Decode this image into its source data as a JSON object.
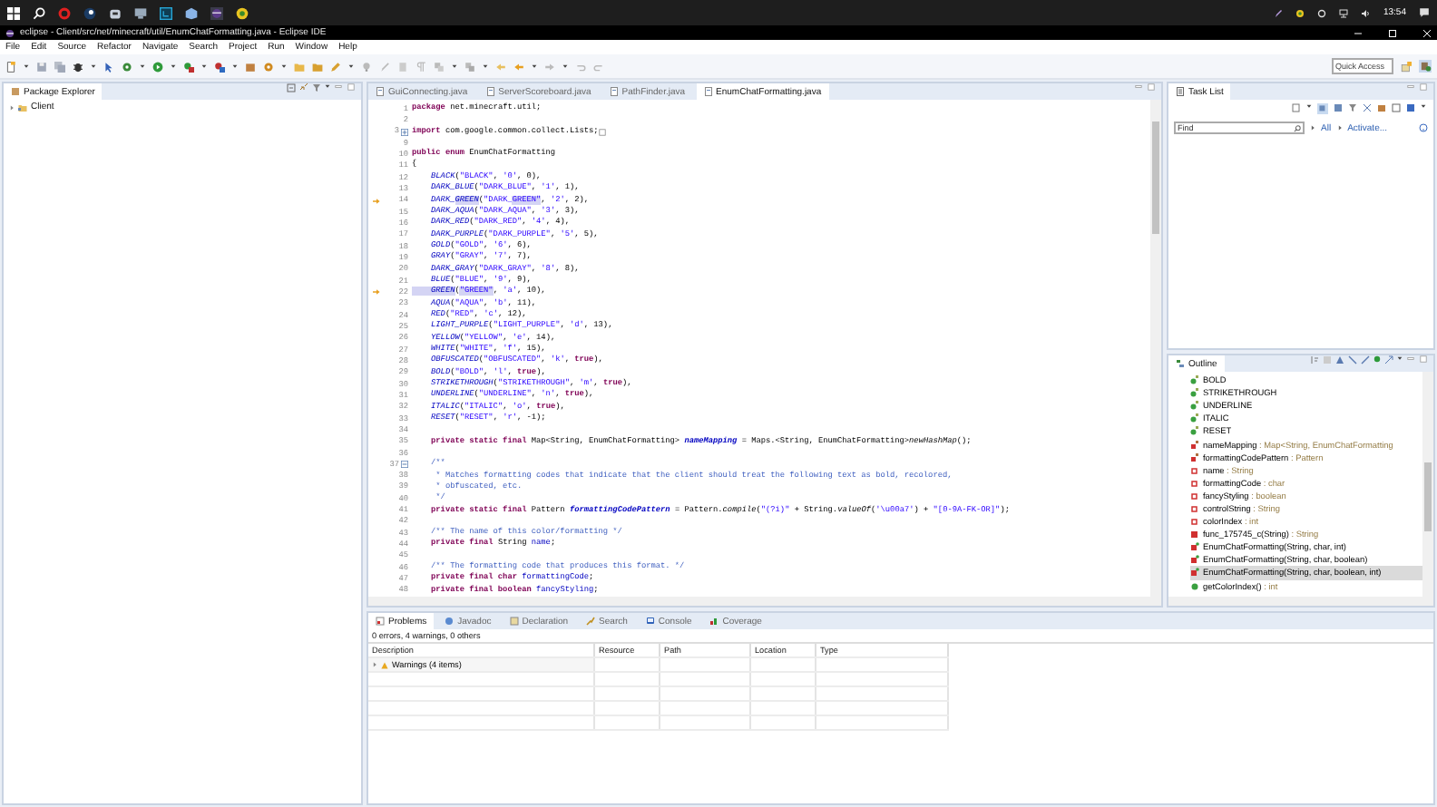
{
  "taskbar": {
    "time": "13:54"
  },
  "window": {
    "title": "eclipse - Client/src/net/minecraft/util/EnumChatFormatting.java - Eclipse IDE"
  },
  "menu": [
    "File",
    "Edit",
    "Source",
    "Refactor",
    "Navigate",
    "Search",
    "Project",
    "Run",
    "Window",
    "Help"
  ],
  "toolbar": {
    "quick_access": {
      "placeholder": "Quick Access"
    }
  },
  "package_explorer": {
    "title": "Package Explorer",
    "items": [
      {
        "label": "Client",
        "expanded": false
      }
    ]
  },
  "editor": {
    "tabs": [
      {
        "label": "GuiConnecting.java",
        "selected": false
      },
      {
        "label": "ServerScoreboard.java",
        "selected": false
      },
      {
        "label": "PathFinder.java",
        "selected": false
      },
      {
        "label": "EnumChatFormatting.java",
        "selected": true
      }
    ],
    "lines": [
      {
        "n": "1",
        "kind": "plain",
        "tokens": [
          {
            "kind": "kw",
            "text": "package "
          },
          {
            "kind": "plain",
            "text": "net.minecraft.util;"
          }
        ]
      },
      {
        "n": "2",
        "kind": "plain"
      },
      {
        "n": "3",
        "kind": "collapsed",
        "tokens": [
          {
            "kind": "kw",
            "text": "import "
          },
          {
            "kind": "plain",
            "text": "com.google.common.collect.Lists;"
          }
        ]
      },
      {
        "n": "9",
        "kind": "plain"
      },
      {
        "n": "10",
        "kind": "plain",
        "tokens": [
          {
            "kind": "kw",
            "text": "public enum "
          },
          {
            "kind": "plain",
            "text": "EnumChatFormatting"
          }
        ]
      },
      {
        "n": "11",
        "kind": "plain",
        "tokens": [
          {
            "kind": "plain",
            "text": "{"
          }
        ]
      },
      {
        "n": "12",
        "kind": "plain",
        "tokens": [
          {
            "kind": "const",
            "text": "    BLACK"
          },
          {
            "kind": "plain",
            "text": "("
          },
          {
            "kind": "str",
            "text": "\"BLACK\""
          },
          {
            "kind": "plain",
            "text": ", "
          },
          {
            "kind": "str",
            "text": "'0'"
          },
          {
            "kind": "plain",
            "text": ", 0),"
          }
        ]
      },
      {
        "n": "13",
        "kind": "plain",
        "tokens": [
          {
            "kind": "const",
            "text": "    DARK_BLUE"
          },
          {
            "kind": "plain",
            "text": "("
          },
          {
            "kind": "str",
            "text": "\"DARK_BLUE\""
          },
          {
            "kind": "plain",
            "text": ", "
          },
          {
            "kind": "str",
            "text": "'1'"
          },
          {
            "kind": "plain",
            "text": ", 1),"
          }
        ]
      },
      {
        "n": "14",
        "kind": "occurrence",
        "tokens": [
          {
            "kind": "const",
            "text": "    DARK_"
          },
          {
            "kind": "consthl",
            "text": "GREEN"
          },
          {
            "kind": "plain",
            "text": "("
          },
          {
            "kind": "str",
            "text": "\"DARK_"
          },
          {
            "kind": "strhl",
            "text": "GREEN\""
          },
          {
            "kind": "plain",
            "text": ", "
          },
          {
            "kind": "str",
            "text": "'2'"
          },
          {
            "kind": "plain",
            "text": ", 2),"
          }
        ]
      },
      {
        "n": "15",
        "kind": "plain",
        "tokens": [
          {
            "kind": "const",
            "text": "    DARK_AQUA"
          },
          {
            "kind": "plain",
            "text": "("
          },
          {
            "kind": "str",
            "text": "\"DARK_AQUA\""
          },
          {
            "kind": "plain",
            "text": ", "
          },
          {
            "kind": "str",
            "text": "'3'"
          },
          {
            "kind": "plain",
            "text": ", 3),"
          }
        ]
      },
      {
        "n": "16",
        "kind": "plain",
        "tokens": [
          {
            "kind": "const",
            "text": "    DARK_RED"
          },
          {
            "kind": "plain",
            "text": "("
          },
          {
            "kind": "str",
            "text": "\"DARK_RED\""
          },
          {
            "kind": "plain",
            "text": ", "
          },
          {
            "kind": "str",
            "text": "'4'"
          },
          {
            "kind": "plain",
            "text": ", 4),"
          }
        ]
      },
      {
        "n": "17",
        "kind": "plain",
        "tokens": [
          {
            "kind": "const",
            "text": "    DARK_PURPLE"
          },
          {
            "kind": "plain",
            "text": "("
          },
          {
            "kind": "str",
            "text": "\"DARK_PURPLE\""
          },
          {
            "kind": "plain",
            "text": ", "
          },
          {
            "kind": "str",
            "text": "'5'"
          },
          {
            "kind": "plain",
            "text": ", 5),"
          }
        ]
      },
      {
        "n": "18",
        "kind": "plain",
        "tokens": [
          {
            "kind": "const",
            "text": "    GOLD"
          },
          {
            "kind": "plain",
            "text": "("
          },
          {
            "kind": "str",
            "text": "\"GOLD\""
          },
          {
            "kind": "plain",
            "text": ", "
          },
          {
            "kind": "str",
            "text": "'6'"
          },
          {
            "kind": "plain",
            "text": ", 6),"
          }
        ]
      },
      {
        "n": "19",
        "kind": "plain",
        "tokens": [
          {
            "kind": "const",
            "text": "    GRAY"
          },
          {
            "kind": "plain",
            "text": "("
          },
          {
            "kind": "str",
            "text": "\"GRAY\""
          },
          {
            "kind": "plain",
            "text": ", "
          },
          {
            "kind": "str",
            "text": "'7'"
          },
          {
            "kind": "plain",
            "text": ", 7),"
          }
        ]
      },
      {
        "n": "20",
        "kind": "plain",
        "tokens": [
          {
            "kind": "const",
            "text": "    DARK_GRAY"
          },
          {
            "kind": "plain",
            "text": "("
          },
          {
            "kind": "str",
            "text": "\"DARK_GRAY\""
          },
          {
            "kind": "plain",
            "text": ", "
          },
          {
            "kind": "str",
            "text": "'8'"
          },
          {
            "kind": "plain",
            "text": ", 8),"
          }
        ]
      },
      {
        "n": "21",
        "kind": "plain",
        "tokens": [
          {
            "kind": "const",
            "text": "    BLUE"
          },
          {
            "kind": "plain",
            "text": "("
          },
          {
            "kind": "str",
            "text": "\"BLUE\""
          },
          {
            "kind": "plain",
            "text": ", "
          },
          {
            "kind": "str",
            "text": "'9'"
          },
          {
            "kind": "plain",
            "text": ", 9),"
          }
        ]
      },
      {
        "n": "22",
        "kind": "occurrence",
        "tokens": [
          {
            "kind": "consthl",
            "text": "    GREEN"
          },
          {
            "kind": "plain",
            "text": "("
          },
          {
            "kind": "strhl",
            "text": "\"GREEN\""
          },
          {
            "kind": "plain",
            "text": ", "
          },
          {
            "kind": "str",
            "text": "'a'"
          },
          {
            "kind": "plain",
            "text": ", 10),"
          }
        ]
      },
      {
        "n": "23",
        "kind": "plain",
        "tokens": [
          {
            "kind": "const",
            "text": "    AQUA"
          },
          {
            "kind": "plain",
            "text": "("
          },
          {
            "kind": "str",
            "text": "\"AQUA\""
          },
          {
            "kind": "plain",
            "text": ", "
          },
          {
            "kind": "str",
            "text": "'b'"
          },
          {
            "kind": "plain",
            "text": ", 11),"
          }
        ]
      },
      {
        "n": "24",
        "kind": "plain",
        "tokens": [
          {
            "kind": "const",
            "text": "    RED"
          },
          {
            "kind": "plain",
            "text": "("
          },
          {
            "kind": "str",
            "text": "\"RED\""
          },
          {
            "kind": "plain",
            "text": ", "
          },
          {
            "kind": "str",
            "text": "'c'"
          },
          {
            "kind": "plain",
            "text": ", 12),"
          }
        ]
      },
      {
        "n": "25",
        "kind": "plain",
        "tokens": [
          {
            "kind": "const",
            "text": "    LIGHT_PURPLE"
          },
          {
            "kind": "plain",
            "text": "("
          },
          {
            "kind": "str",
            "text": "\"LIGHT_PURPLE\""
          },
          {
            "kind": "plain",
            "text": ", "
          },
          {
            "kind": "str",
            "text": "'d'"
          },
          {
            "kind": "plain",
            "text": ", 13),"
          }
        ]
      },
      {
        "n": "26",
        "kind": "plain",
        "tokens": [
          {
            "kind": "const",
            "text": "    YELLOW"
          },
          {
            "kind": "plain",
            "text": "("
          },
          {
            "kind": "str",
            "text": "\"YELLOW\""
          },
          {
            "kind": "plain",
            "text": ", "
          },
          {
            "kind": "str",
            "text": "'e'"
          },
          {
            "kind": "plain",
            "text": ", 14),"
          }
        ]
      },
      {
        "n": "27",
        "kind": "plain",
        "tokens": [
          {
            "kind": "const",
            "text": "    WHITE"
          },
          {
            "kind": "plain",
            "text": "("
          },
          {
            "kind": "str",
            "text": "\"WHITE\""
          },
          {
            "kind": "plain",
            "text": ", "
          },
          {
            "kind": "str",
            "text": "'f'"
          },
          {
            "kind": "plain",
            "text": ", 15),"
          }
        ]
      },
      {
        "n": "28",
        "kind": "plain",
        "tokens": [
          {
            "kind": "const",
            "text": "    OBFUSCATED"
          },
          {
            "kind": "plain",
            "text": "("
          },
          {
            "kind": "str",
            "text": "\"OBFUSCATED\""
          },
          {
            "kind": "plain",
            "text": ", "
          },
          {
            "kind": "str",
            "text": "'k'"
          },
          {
            "kind": "plain",
            "text": ", "
          },
          {
            "kind": "kw",
            "text": "true"
          },
          {
            "kind": "plain",
            "text": "),"
          }
        ]
      },
      {
        "n": "29",
        "kind": "plain",
        "tokens": [
          {
            "kind": "const",
            "text": "    BOLD"
          },
          {
            "kind": "plain",
            "text": "("
          },
          {
            "kind": "str",
            "text": "\"BOLD\""
          },
          {
            "kind": "plain",
            "text": ", "
          },
          {
            "kind": "str",
            "text": "'l'"
          },
          {
            "kind": "plain",
            "text": ", "
          },
          {
            "kind": "kw",
            "text": "true"
          },
          {
            "kind": "plain",
            "text": "),"
          }
        ]
      },
      {
        "n": "30",
        "kind": "plain",
        "tokens": [
          {
            "kind": "const",
            "text": "    STRIKETHROUGH"
          },
          {
            "kind": "plain",
            "text": "("
          },
          {
            "kind": "str",
            "text": "\"STRIKETHROUGH\""
          },
          {
            "kind": "plain",
            "text": ", "
          },
          {
            "kind": "str",
            "text": "'m'"
          },
          {
            "kind": "plain",
            "text": ", "
          },
          {
            "kind": "kw",
            "text": "true"
          },
          {
            "kind": "plain",
            "text": "),"
          }
        ]
      },
      {
        "n": "31",
        "kind": "plain",
        "tokens": [
          {
            "kind": "const",
            "text": "    UNDERLINE"
          },
          {
            "kind": "plain",
            "text": "("
          },
          {
            "kind": "str",
            "text": "\"UNDERLINE\""
          },
          {
            "kind": "plain",
            "text": ", "
          },
          {
            "kind": "str",
            "text": "'n'"
          },
          {
            "kind": "plain",
            "text": ", "
          },
          {
            "kind": "kw",
            "text": "true"
          },
          {
            "kind": "plain",
            "text": "),"
          }
        ]
      },
      {
        "n": "32",
        "kind": "plain",
        "tokens": [
          {
            "kind": "const",
            "text": "    ITALIC"
          },
          {
            "kind": "plain",
            "text": "("
          },
          {
            "kind": "str",
            "text": "\"ITALIC\""
          },
          {
            "kind": "plain",
            "text": ", "
          },
          {
            "kind": "str",
            "text": "'o'"
          },
          {
            "kind": "plain",
            "text": ", "
          },
          {
            "kind": "kw",
            "text": "true"
          },
          {
            "kind": "plain",
            "text": "),"
          }
        ]
      },
      {
        "n": "33",
        "kind": "plain",
        "tokens": [
          {
            "kind": "const",
            "text": "    RESET"
          },
          {
            "kind": "plain",
            "text": "("
          },
          {
            "kind": "str",
            "text": "\"RESET\""
          },
          {
            "kind": "plain",
            "text": ", "
          },
          {
            "kind": "str",
            "text": "'r'"
          },
          {
            "kind": "plain",
            "text": ", -1);"
          }
        ]
      },
      {
        "n": "34",
        "kind": "plain"
      },
      {
        "n": "35",
        "kind": "plain",
        "tokens": [
          {
            "kind": "kw",
            "text": "    private static final "
          },
          {
            "kind": "plain",
            "text": "Map<String, EnumChatFormatting> "
          },
          {
            "kind": "sfield",
            "text": "nameMapping"
          },
          {
            "kind": "plain",
            "text": " = Maps.<String, EnumChatFormatting>"
          },
          {
            "kind": "smethod",
            "text": "newHashMap"
          },
          {
            "kind": "plain",
            "text": "();"
          }
        ]
      },
      {
        "n": "36",
        "kind": "plain"
      },
      {
        "n": "37",
        "kind": "expanded",
        "tokens": [
          {
            "kind": "doc",
            "text": "    /**"
          }
        ]
      },
      {
        "n": "38",
        "kind": "plain",
        "tokens": [
          {
            "kind": "doc",
            "text": "     * Matches formatting codes that indicate that the client should treat the following text as bold, recolored,"
          }
        ]
      },
      {
        "n": "39",
        "kind": "plain",
        "tokens": [
          {
            "kind": "doc",
            "text": "     * obfuscated, etc."
          }
        ]
      },
      {
        "n": "40",
        "kind": "plain",
        "tokens": [
          {
            "kind": "doc",
            "text": "     */"
          }
        ]
      },
      {
        "n": "41",
        "kind": "plain",
        "tokens": [
          {
            "kind": "kw",
            "text": "    private static final "
          },
          {
            "kind": "plain",
            "text": "Pattern "
          },
          {
            "kind": "sfield",
            "text": "formattingCodePattern"
          },
          {
            "kind": "plain",
            "text": " = Pattern."
          },
          {
            "kind": "smethod",
            "text": "compile"
          },
          {
            "kind": "plain",
            "text": "("
          },
          {
            "kind": "str",
            "text": "\"(?i)\""
          },
          {
            "kind": "plain",
            "text": " + String."
          },
          {
            "kind": "smethod",
            "text": "valueOf"
          },
          {
            "kind": "plain",
            "text": "("
          },
          {
            "kind": "str",
            "text": "'\\u00a7'"
          },
          {
            "kind": "plain",
            "text": ") + "
          },
          {
            "kind": "str",
            "text": "\"[0-9A-FK-OR]\""
          },
          {
            "kind": "plain",
            "text": ");"
          }
        ]
      },
      {
        "n": "42",
        "kind": "plain"
      },
      {
        "n": "43",
        "kind": "plain",
        "tokens": [
          {
            "kind": "doc",
            "text": "    /** The name of this color/formatting */"
          }
        ]
      },
      {
        "n": "44",
        "kind": "plain",
        "tokens": [
          {
            "kind": "kw",
            "text": "    private final "
          },
          {
            "kind": "plain",
            "text": "String "
          },
          {
            "kind": "field",
            "text": "name"
          },
          {
            "kind": "plain",
            "text": ";"
          }
        ]
      },
      {
        "n": "45",
        "kind": "plain"
      },
      {
        "n": "46",
        "kind": "plain",
        "tokens": [
          {
            "kind": "doc",
            "text": "    /** The formatting code that produces this format. */"
          }
        ]
      },
      {
        "n": "47",
        "kind": "plain",
        "tokens": [
          {
            "kind": "kw",
            "text": "    private final char "
          },
          {
            "kind": "field",
            "text": "formattingCode"
          },
          {
            "kind": "plain",
            "text": ";"
          }
        ]
      },
      {
        "n": "48",
        "kind": "plain",
        "tokens": [
          {
            "kind": "kw",
            "text": "    private final boolean "
          },
          {
            "kind": "field",
            "text": "fancyStyling"
          },
          {
            "kind": "plain",
            "text": ";"
          }
        ]
      }
    ]
  },
  "task_list": {
    "title": "Task List",
    "find": {
      "placeholder": "Find"
    },
    "links": [
      "All",
      "Activate..."
    ]
  },
  "outline": {
    "title": "Outline",
    "items": [
      {
        "kind": "constant",
        "name": "BOLD",
        "selected": false
      },
      {
        "kind": "constant",
        "name": "STRIKETHROUGH",
        "selected": false
      },
      {
        "kind": "constant",
        "name": "UNDERLINE",
        "selected": false
      },
      {
        "kind": "constant",
        "name": "ITALIC",
        "selected": false
      },
      {
        "kind": "constant",
        "name": "RESET",
        "selected": false
      },
      {
        "kind": "static-field",
        "name": "nameMapping",
        "type": ": Map<String, EnumChatFormatting",
        "selected": false
      },
      {
        "kind": "static-field",
        "name": "formattingCodePattern",
        "type": ": Pattern",
        "selected": false
      },
      {
        "kind": "field",
        "name": "name",
        "type": ": String",
        "selected": false
      },
      {
        "kind": "field",
        "name": "formattingCode",
        "type": ": char",
        "selected": false
      },
      {
        "kind": "field",
        "name": "fancyStyling",
        "type": ": boolean",
        "selected": false
      },
      {
        "kind": "field",
        "name": "controlString",
        "type": ": String",
        "selected": false
      },
      {
        "kind": "field",
        "name": "colorIndex",
        "type": ": int",
        "selected": false
      },
      {
        "kind": "method",
        "name": "func_175745_c(String)",
        "type": ": String",
        "selected": false
      },
      {
        "kind": "constructor",
        "name": "EnumChatFormatting(String, char, int)",
        "selected": false
      },
      {
        "kind": "constructor",
        "name": "EnumChatFormatting(String, char, boolean)",
        "selected": false
      },
      {
        "kind": "constructor",
        "name": "EnumChatFormatting(String, char, boolean, int)",
        "selected": true
      },
      {
        "kind": "public-method",
        "name": "getColorIndex()",
        "type": ": int",
        "selected": false
      }
    ]
  },
  "problems": {
    "tabs": [
      {
        "label": "Problems",
        "selected": true
      },
      {
        "label": "Javadoc",
        "selected": false
      },
      {
        "label": "Declaration",
        "selected": false
      },
      {
        "label": "Search",
        "selected": false
      },
      {
        "label": "Console",
        "selected": false
      },
      {
        "label": "Coverage",
        "selected": false
      }
    ],
    "summary": "0 errors, 4 warnings, 0 others",
    "columns": [
      "Description",
      "Resource",
      "Path",
      "Location",
      "Type"
    ],
    "rows": [
      {
        "label": "Warnings (4 items)",
        "expanded": false
      }
    ]
  }
}
